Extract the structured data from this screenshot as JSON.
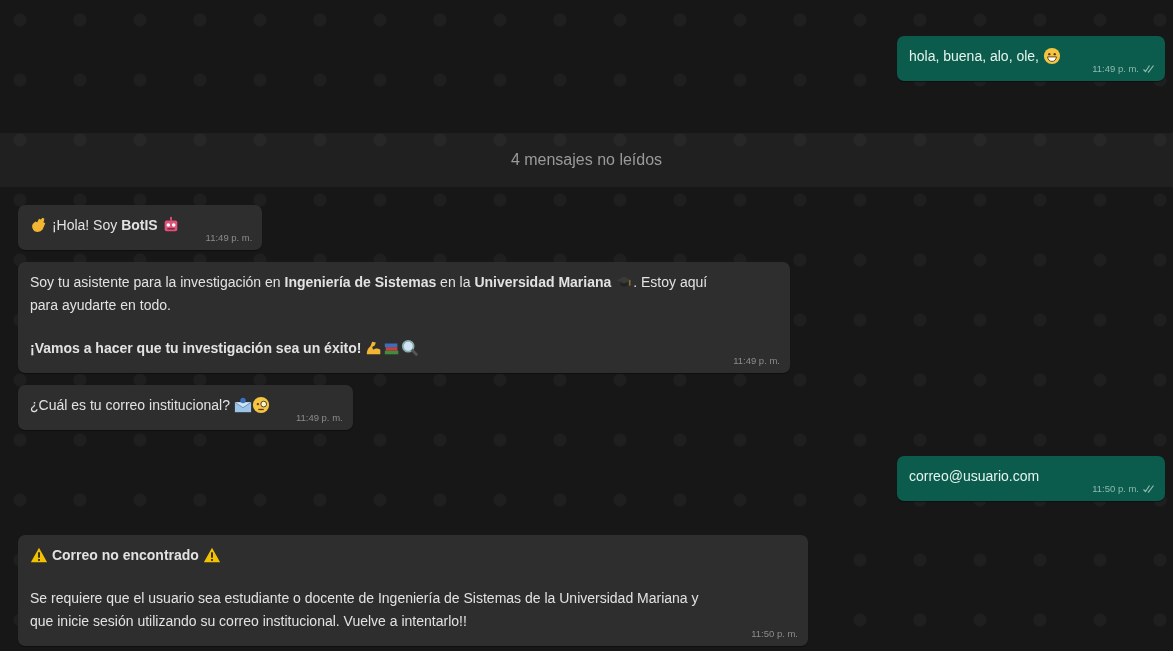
{
  "chat": [
    {
      "kind": "message",
      "outgoing": true,
      "read": false,
      "time": "11:49 p. m.",
      "paragraphs": [
        [
          {
            "kind": "text",
            "text": "hola, buena, alo, ole, "
          },
          {
            "kind": "icon"
          }
        ]
      ]
    },
    {
      "kind": "divider",
      "text": "4 mensajes no leídos"
    },
    {
      "kind": "message",
      "outgoing": false,
      "time": "11:49 p. m.",
      "paragraphs": [
        [
          {
            "kind": "icon"
          },
          {
            "kind": "text",
            "text": " ¡Hola! Soy **BotIS** "
          },
          {
            "kind": "icon"
          }
        ]
      ]
    },
    {
      "kind": "message",
      "outgoing": false,
      "time": "11:49 p. m.",
      "paragraphs": [
        [
          {
            "kind": "text",
            "text": "Soy tu asistente para la investigación en **Ingeniería de Sistemas** en la **Universidad Mariana** "
          },
          {
            "kind": "icon"
          },
          {
            "kind": "text",
            "text": ". Estoy aquí"
          },
          {
            "kind": "break"
          },
          {
            "kind": "text",
            "text": "para ayudarte en todo."
          }
        ],
        [
          {
            "kind": "text",
            "text": "**¡Vamos a hacer que tu investigación sea un éxito!** "
          },
          {
            "kind": "icon"
          },
          {
            "kind": "icon"
          },
          {
            "kind": "icon"
          }
        ]
      ]
    },
    {
      "kind": "message",
      "outgoing": false,
      "time": "11:49 p. m.",
      "paragraphs": [
        [
          {
            "kind": "text",
            "text": "¿Cuál es tu correo institucional? "
          },
          {
            "kind": "icon"
          },
          {
            "kind": "icon"
          }
        ]
      ]
    },
    {
      "kind": "message",
      "outgoing": true,
      "read": false,
      "time": "11:50 p. m.",
      "paragraphs": [
        [
          {
            "kind": "text",
            "text": "correo@usuario.com"
          }
        ]
      ]
    },
    {
      "kind": "message",
      "outgoing": false,
      "time": "11:50 p. m.",
      "paragraphs": [
        [
          {
            "kind": "icon"
          },
          {
            "kind": "text",
            "text": " **Correo no encontrado** "
          },
          {
            "kind": "icon"
          }
        ],
        [
          {
            "kind": "text",
            "text": "Se requiere que el usuario sea estudiante o docente de Ingeniería de Sistemas de la Universidad Mariana y que inicie sesión utilizando su correo institucional. Vuelve a intentarlo!!"
          }
        ]
      ]
    }
  ]
}
